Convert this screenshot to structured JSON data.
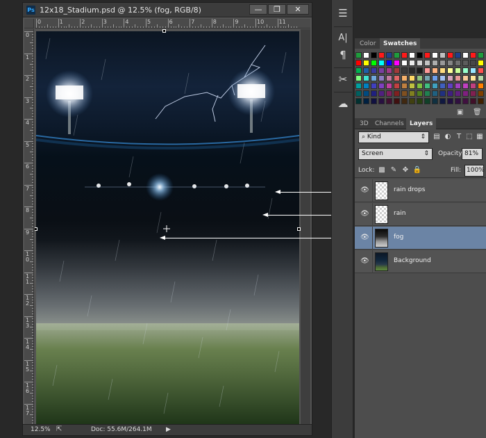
{
  "document": {
    "title": "12x18_Stadium.psd @ 12.5% (fog, RGB/8)",
    "app_icon": "Ps",
    "window_buttons": {
      "minimize": "—",
      "maximize": "❐",
      "close": "✕"
    },
    "ruler_top_labels": [
      "0",
      "1",
      "2",
      "3",
      "4",
      "5",
      "6",
      "7",
      "8",
      "9",
      "10",
      "11"
    ],
    "ruler_left_labels": [
      "0",
      "1",
      "2",
      "3",
      "4",
      "5",
      "6",
      "7",
      "8",
      "9",
      "1\n0",
      "1\n1",
      "1\n2",
      "1\n3",
      "1\n4",
      "1\n5",
      "1\n6",
      "1\n7"
    ],
    "status": {
      "zoom": "12.5%",
      "doc_size": "Doc: 55.6M/264.1M",
      "export_icon": "share-icon",
      "arrow": "▶"
    }
  },
  "tools": [
    {
      "name": "properties-panel-icon",
      "glyph": "≡"
    },
    {
      "name": "character-panel-icon",
      "glyph": "A|"
    },
    {
      "name": "paragraph-panel-icon",
      "glyph": "¶"
    },
    {
      "name": "tool-presets-icon",
      "glyph": "✂"
    },
    {
      "name": "libraries-icon",
      "glyph": "☁"
    }
  ],
  "swatches_panel": {
    "tabs": [
      {
        "label": "Color",
        "active": false
      },
      {
        "label": "Swatches",
        "active": true
      }
    ],
    "new_icon": "new-swatch-icon",
    "trash_icon": "trash-icon",
    "colors": [
      [
        "#1f9c3c",
        "#ffffff",
        "#000000",
        "#ff1a1a",
        "#1f3f8a",
        "#1f9c3c",
        "#ff1a1a",
        "#ffffff",
        "#000000",
        "#ff1a1a",
        "#ffffff",
        "#c0c0c0",
        "#ff1a1a",
        "#1f3f8a",
        "#ffffff",
        "#ff1a1a",
        "#1f9c3c"
      ],
      [
        "#ff0000",
        "#ffff00",
        "#00ff00",
        "#00ffff",
        "#0000ff",
        "#ff00ff",
        "#ffffff",
        "#ebebeb",
        "#d6d6d6",
        "#c2c2c2",
        "#adadad",
        "#999999",
        "#858585",
        "#707070",
        "#5c5c5c",
        "#474747",
        "#ffff00"
      ],
      [
        "#00b050",
        "#1f5fa8",
        "#3a3aa0",
        "#7a3fa0",
        "#a03a8a",
        "#a03a3a",
        "#3a3a3a",
        "#2a2a2a",
        "#1a1a1a",
        "#ff9999",
        "#ffb380",
        "#ffdd80",
        "#ffff99",
        "#ccff99",
        "#99ffcc",
        "#99e6ff",
        "#ff5050"
      ],
      [
        "#80ff80",
        "#40e0d0",
        "#6fa8dc",
        "#8e7cc3",
        "#c27ba0",
        "#e06666",
        "#f6b26b",
        "#ffd966",
        "#93c47d",
        "#76a5af",
        "#6d9eeb",
        "#a4c2f4",
        "#d5a6bd",
        "#ea9999",
        "#f9cb9c",
        "#ffe599",
        "#b6d7a8"
      ],
      [
        "#00a0a0",
        "#0080c0",
        "#4040c0",
        "#8040c0",
        "#c040a0",
        "#c04040",
        "#c08040",
        "#c0c040",
        "#80c040",
        "#40c080",
        "#40a0c0",
        "#4060c0",
        "#6040c0",
        "#a040c0",
        "#c040c0",
        "#c04080",
        "#ff8000"
      ],
      [
        "#006060",
        "#004a80",
        "#202080",
        "#502080",
        "#802060",
        "#802020",
        "#805020",
        "#808020",
        "#508020",
        "#208050",
        "#206080",
        "#203080",
        "#402080",
        "#602080",
        "#802080",
        "#802050",
        "#804000"
      ],
      [
        "#003030",
        "#002040",
        "#101040",
        "#281040",
        "#401030",
        "#401010",
        "#402810",
        "#404010",
        "#284010",
        "#104028",
        "#103040",
        "#101840",
        "#201040",
        "#301040",
        "#401040",
        "#401028",
        "#402000"
      ]
    ]
  },
  "layers_panel": {
    "tabs": [
      {
        "label": "3D",
        "active": false
      },
      {
        "label": "Channels",
        "active": false
      },
      {
        "label": "Layers",
        "active": true
      }
    ],
    "filter_kind": "Kind",
    "filter_icons": [
      "image-filter-icon",
      "adjustment-filter-icon",
      "type-filter-icon",
      "shape-filter-icon",
      "smart-object-filter-icon"
    ],
    "blend_mode": "Screen",
    "opacity_label": "Opacity:",
    "opacity_value": "81%",
    "lock_label": "Lock:",
    "fill_label": "Fill:",
    "fill_value": "100%",
    "layers": [
      {
        "name": "rain drops",
        "thumb": "transparent",
        "selected": false
      },
      {
        "name": "rain",
        "thumb": "transparent",
        "selected": false
      },
      {
        "name": "fog",
        "thumb": "fog",
        "selected": true
      },
      {
        "name": "Background",
        "thumb": "background",
        "selected": false
      }
    ]
  }
}
